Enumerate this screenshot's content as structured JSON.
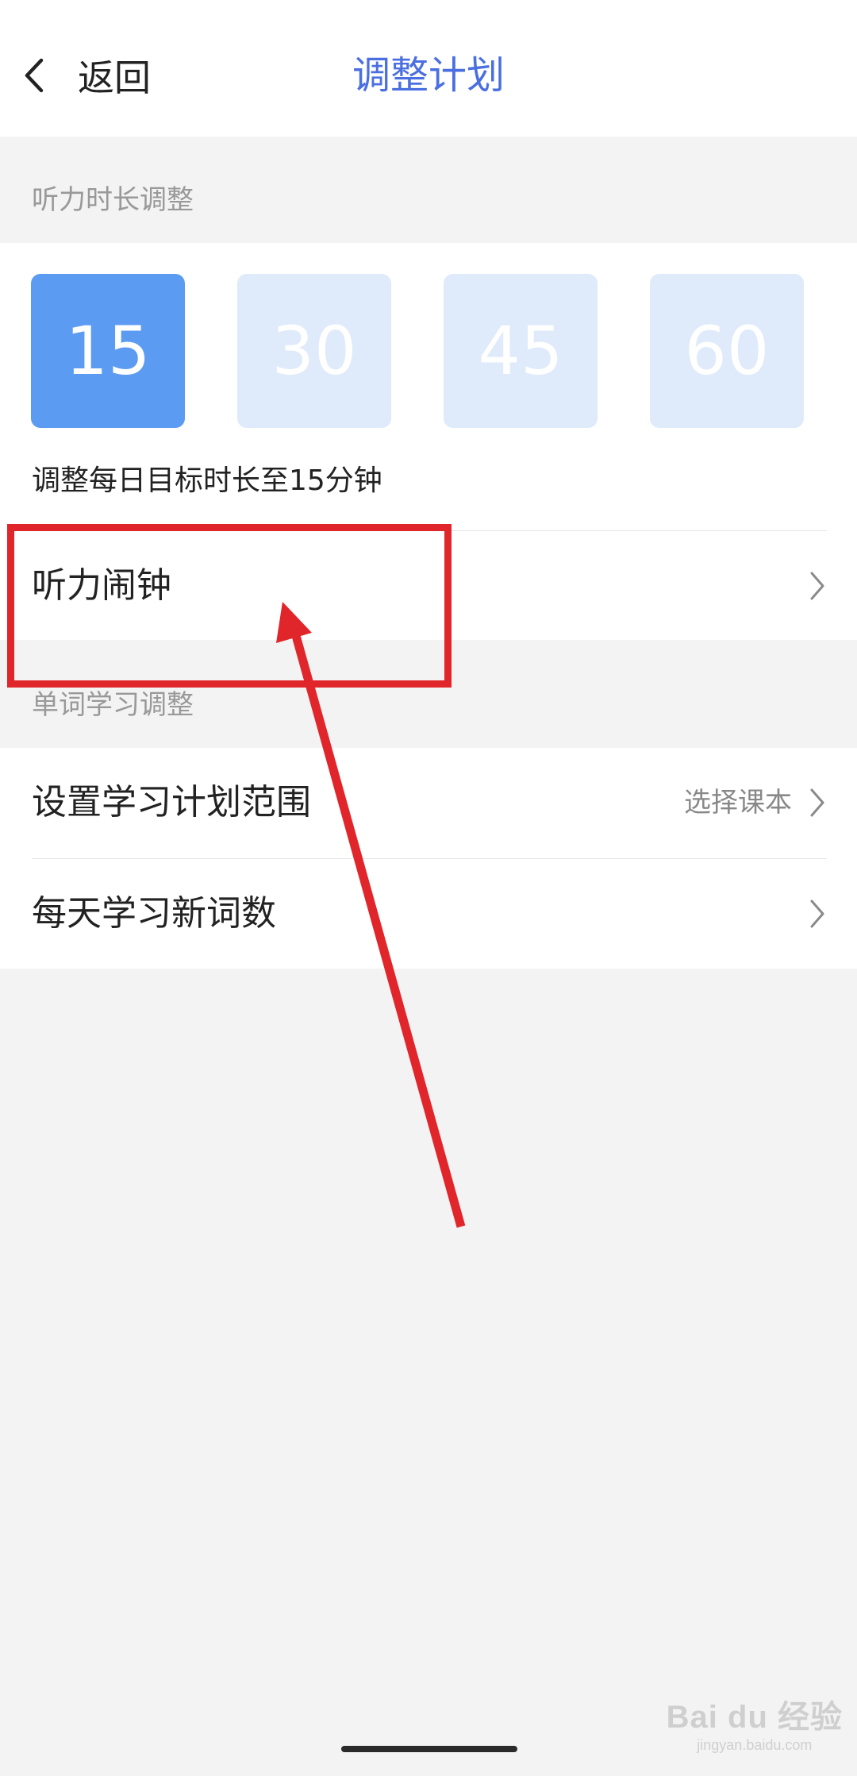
{
  "nav": {
    "back_label": "返回",
    "title": "调整计划"
  },
  "listening": {
    "section_title": "听力时长调整",
    "options": [
      "15",
      "30",
      "45",
      "60"
    ],
    "selected_option": "15",
    "description": "调整每日目标时长至15分钟",
    "alarm_label": "听力闹钟"
  },
  "vocabulary": {
    "section_title": "单词学习调整",
    "plan_range_label": "设置学习计划范围",
    "plan_range_value": "选择课本",
    "daily_new_words_label": "每天学习新词数"
  },
  "watermark": {
    "main": "Bai du 经验",
    "sub": "jingyan.baidu.com"
  },
  "colors": {
    "accent": "#4a6fe0",
    "selected_option": "#5b9bf2",
    "unselected_option": "#dfeafb",
    "annotation": "#e0262b",
    "background": "#f3f3f3"
  },
  "icons": {
    "back": "chevron-left-icon",
    "row_arrow": "chevron-right-icon"
  }
}
